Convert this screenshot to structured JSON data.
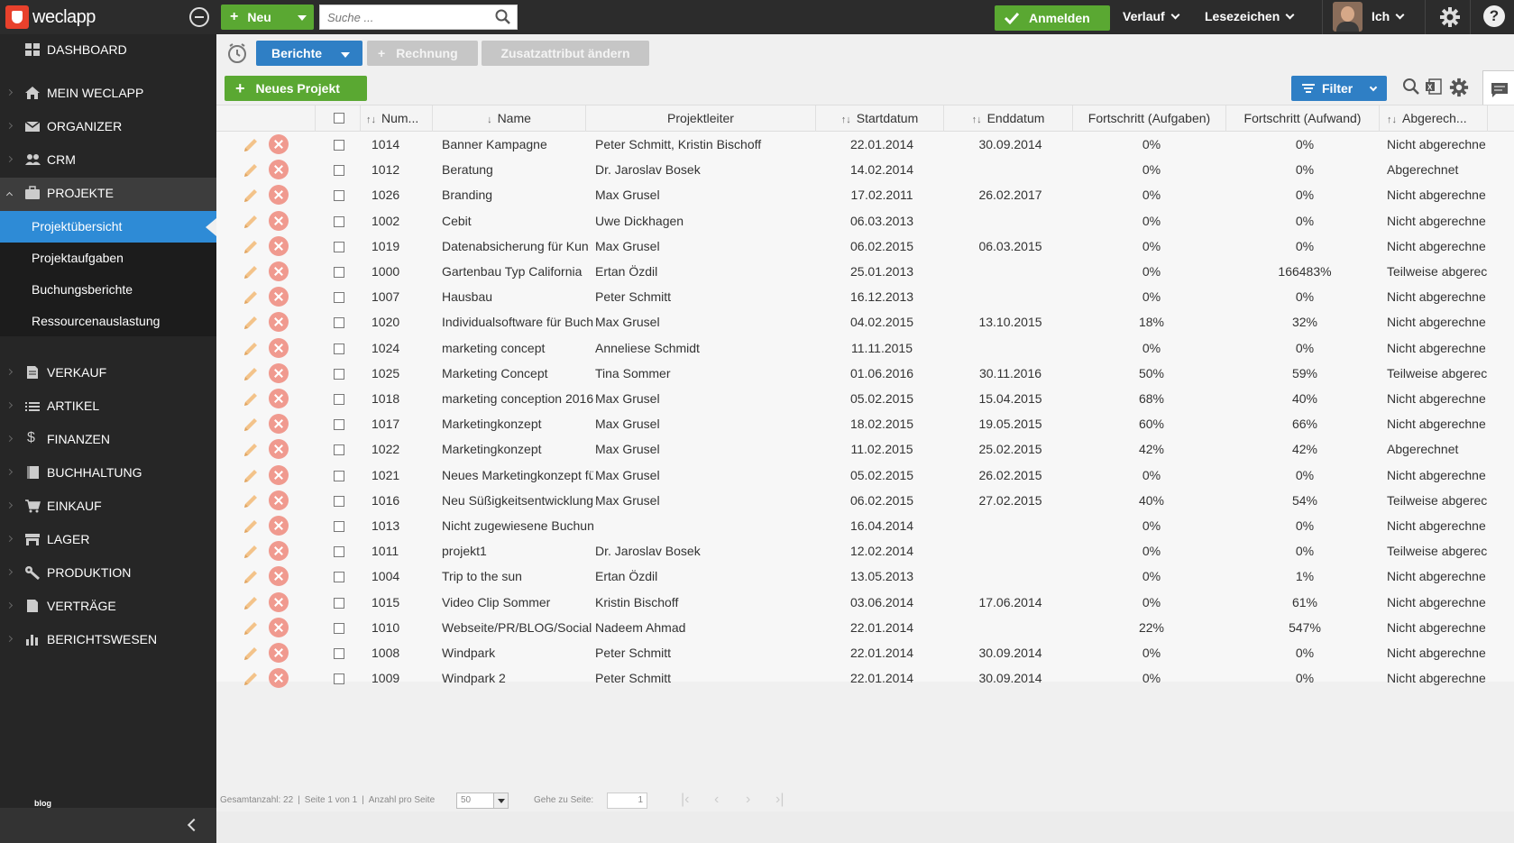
{
  "app": {
    "logo_text": "weclapp"
  },
  "topbar": {
    "new_label": "Neu",
    "search_placeholder": "Suche ...",
    "login_label": "Anmelden",
    "history_label": "Verlauf",
    "bookmarks_label": "Lesezeichen",
    "user_label": "Ich",
    "help_label": "?"
  },
  "sidebar": {
    "items": [
      {
        "label": "DASHBOARD",
        "icon": "dashboard-icon"
      },
      {
        "label": "MEIN WECLAPP",
        "icon": "home-icon"
      },
      {
        "label": "ORGANIZER",
        "icon": "mail-icon"
      },
      {
        "label": "CRM",
        "icon": "people-icon"
      },
      {
        "label": "PROJEKTE",
        "icon": "briefcase-icon"
      },
      {
        "label": "VERKAUF",
        "icon": "document-icon"
      },
      {
        "label": "ARTIKEL",
        "icon": "list-icon"
      },
      {
        "label": "FINANZEN",
        "icon": "dollar-icon"
      },
      {
        "label": "BUCHHALTUNG",
        "icon": "book-icon"
      },
      {
        "label": "EINKAUF",
        "icon": "cart-icon"
      },
      {
        "label": "LAGER",
        "icon": "warehouse-icon"
      },
      {
        "label": "PRODUKTION",
        "icon": "wrench-icon"
      },
      {
        "label": "VERTRÄGE",
        "icon": "contract-icon"
      },
      {
        "label": "BERICHTSWESEN",
        "icon": "bar-chart-icon"
      }
    ],
    "sub_items": [
      {
        "label": "Projektübersicht"
      },
      {
        "label": "Projektaufgaben"
      },
      {
        "label": "Buchungsberichte"
      },
      {
        "label": "Ressourcenauslastung"
      }
    ],
    "footer_label": "blog"
  },
  "toolbar": {
    "reports_label": "Berichte",
    "invoice_label": "Rechnung",
    "attribute_label": "Zusatzattribut ändern",
    "new_project_label": "Neues Projekt",
    "filter_label": "Filter"
  },
  "table": {
    "columns": [
      "Num...",
      "Name",
      "Projektleiter",
      "Startdatum",
      "Enddatum",
      "Fortschritt (Aufgaben)",
      "Fortschritt (Aufwand)",
      "Abgerech..."
    ],
    "rows": [
      [
        "1014",
        "Banner Kampagne",
        "Peter Schmitt, Kristin Bischoff",
        "22.01.2014",
        "30.09.2014",
        "0%",
        "0%",
        "Nicht abgerechne"
      ],
      [
        "1012",
        "Beratung",
        "Dr. Jaroslav Bosek",
        "14.02.2014",
        "",
        "0%",
        "0%",
        "Abgerechnet"
      ],
      [
        "1026",
        "Branding",
        "Max Grusel",
        "17.02.2011",
        "26.02.2017",
        "0%",
        "0%",
        "Nicht abgerechne"
      ],
      [
        "1002",
        "Cebit",
        "Uwe Dickhagen",
        "06.03.2013",
        "",
        "0%",
        "0%",
        "Nicht abgerechne"
      ],
      [
        "1019",
        "Datenabsicherung für Kun",
        "Max Grusel",
        "06.02.2015",
        "06.03.2015",
        "0%",
        "0%",
        "Nicht abgerechne"
      ],
      [
        "1000",
        "Gartenbau Typ California",
        "Ertan Özdil",
        "25.01.2013",
        "",
        "0%",
        "166483%",
        "Teilweise abgerec"
      ],
      [
        "1007",
        "Hausbau",
        "Peter Schmitt",
        "16.12.2013",
        "",
        "0%",
        "0%",
        "Nicht abgerechne"
      ],
      [
        "1020",
        "Individualsoftware für Buch",
        "Max Grusel",
        "04.02.2015",
        "13.10.2015",
        "18%",
        "32%",
        "Nicht abgerechne"
      ],
      [
        "1024",
        "marketing concept",
        "Anneliese Schmidt",
        "11.11.2015",
        "",
        "0%",
        "0%",
        "Nicht abgerechne"
      ],
      [
        "1025",
        "Marketing Concept",
        "Tina Sommer",
        "01.06.2016",
        "30.11.2016",
        "50%",
        "59%",
        "Teilweise abgerec"
      ],
      [
        "1018",
        "marketing conception 2016",
        "Max Grusel",
        "05.02.2015",
        "15.04.2015",
        "68%",
        "40%",
        "Nicht abgerechne"
      ],
      [
        "1017",
        "Marketingkonzept",
        "Max Grusel",
        "18.02.2015",
        "19.05.2015",
        "60%",
        "66%",
        "Nicht abgerechne"
      ],
      [
        "1022",
        "Marketingkonzept",
        "Max Grusel",
        "11.02.2015",
        "25.02.2015",
        "42%",
        "42%",
        "Abgerechnet"
      ],
      [
        "1021",
        "Neues Marketingkonzept fü",
        "Max Grusel",
        "05.02.2015",
        "26.02.2015",
        "0%",
        "0%",
        "Nicht abgerechne"
      ],
      [
        "1016",
        "Neu Süßigkeitsentwicklung",
        "Max Grusel",
        "06.02.2015",
        "27.02.2015",
        "40%",
        "54%",
        "Teilweise abgerec"
      ],
      [
        "1013",
        "Nicht zugewiesene Buchun",
        "",
        "16.04.2014",
        "",
        "0%",
        "0%",
        "Nicht abgerechne"
      ],
      [
        "1011",
        "projekt1",
        "Dr. Jaroslav Bosek",
        "12.02.2014",
        "",
        "0%",
        "0%",
        "Teilweise abgerec"
      ],
      [
        "1004",
        "Trip to the sun",
        "Ertan Özdil",
        "13.05.2013",
        "",
        "0%",
        "1%",
        "Nicht abgerechne"
      ],
      [
        "1015",
        "Video Clip Sommer",
        "Kristin Bischoff",
        "03.06.2014",
        "17.06.2014",
        "0%",
        "61%",
        "Nicht abgerechne"
      ],
      [
        "1010",
        "Webseite/PR/BLOG/Social",
        "Nadeem Ahmad",
        "22.01.2014",
        "",
        "22%",
        "547%",
        "Nicht abgerechne"
      ],
      [
        "1008",
        "Windpark",
        "Peter Schmitt",
        "22.01.2014",
        "30.09.2014",
        "0%",
        "0%",
        "Nicht abgerechne"
      ],
      [
        "1009",
        "Windpark 2",
        "Peter Schmitt",
        "22.01.2014",
        "30.09.2014",
        "0%",
        "0%",
        "Nicht abgerechne"
      ]
    ]
  },
  "pager": {
    "total": "Gesamtanzahl: 22",
    "page_info": "Seite 1 von 1",
    "per_page_label": "Anzahl pro Seite",
    "per_page_value": "50",
    "goto_label": "Gehe zu Seite:",
    "goto_value": "1"
  },
  "colors": {
    "green": "#5aa832",
    "blue": "#2f7fc5",
    "sidebar": "#262626",
    "selected": "#2e8bd6",
    "delete": "#f09a8f"
  }
}
